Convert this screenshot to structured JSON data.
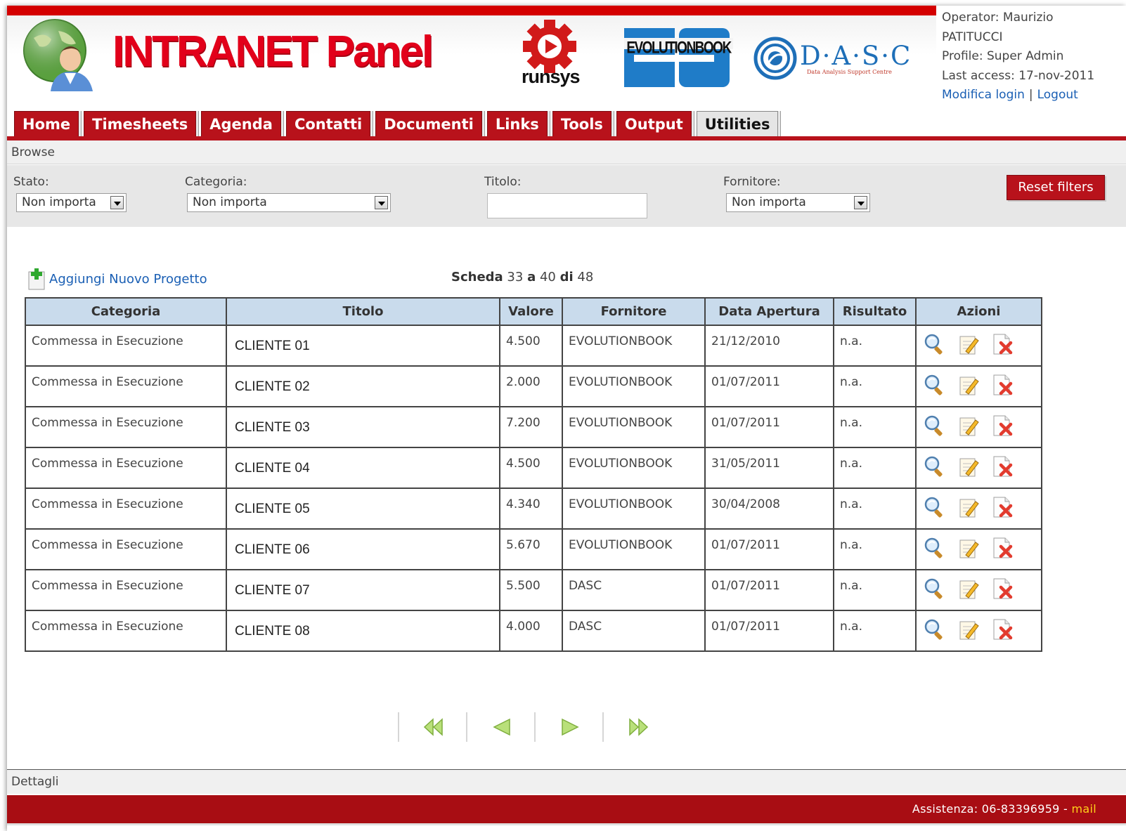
{
  "brand": {
    "title": "INTRANET Panel",
    "runsys": "runsys",
    "evolutionbook": "EVOLUTIONBOOK",
    "dasc": "D·A·S·C",
    "dasc_sub": "Data Analysis Support Centre"
  },
  "user": {
    "operator_line1": "Operator: Maurizio",
    "operator_line2": "PATITUCCI",
    "profile": "Profile: Super Admin",
    "last_access": "Last access: 17-nov-2011",
    "modifica_login": "Modifica login",
    "separator": "|",
    "logout": "Logout"
  },
  "tabs": [
    {
      "label": "Home"
    },
    {
      "label": "Timesheets"
    },
    {
      "label": "Agenda"
    },
    {
      "label": "Contatti"
    },
    {
      "label": "Documenti"
    },
    {
      "label": "Links"
    },
    {
      "label": "Tools"
    },
    {
      "label": "Output"
    },
    {
      "label": "Utilities",
      "active": true
    }
  ],
  "breadcrumb": "Browse",
  "filters": {
    "stato_label": "Stato:",
    "stato_value": "Non importa",
    "categoria_label": "Categoria:",
    "categoria_value": "Non importa",
    "titolo_label": "Titolo:",
    "titolo_value": "",
    "fornitore_label": "Fornitore:",
    "fornitore_value": "Non importa",
    "reset_label": "Reset filters"
  },
  "add_project": "Aggiungi Nuovo Progetto",
  "pager": {
    "scheda": "Scheda",
    "from": "33",
    "a": "a",
    "to": "40",
    "di": "di",
    "total": "48"
  },
  "table": {
    "headers": [
      "Categoria",
      "Titolo",
      "Valore",
      "Fornitore",
      "Data Apertura",
      "Risultato",
      "Azioni"
    ],
    "rows": [
      [
        "Commessa in Esecuzione",
        "CLIENTE 01",
        "4.500",
        "EVOLUTIONBOOK",
        "21/12/2010",
        "n.a."
      ],
      [
        "Commessa in Esecuzione",
        "CLIENTE 02",
        "2.000",
        "EVOLUTIONBOOK",
        "01/07/2011",
        "n.a."
      ],
      [
        "Commessa in Esecuzione",
        "CLIENTE 03",
        "7.200",
        "EVOLUTIONBOOK",
        "01/07/2011",
        "n.a."
      ],
      [
        "Commessa in Esecuzione",
        "CLIENTE 04",
        "4.500",
        "EVOLUTIONBOOK",
        "31/05/2011",
        "n.a."
      ],
      [
        "Commessa in Esecuzione",
        "CLIENTE 05",
        "4.340",
        "EVOLUTIONBOOK",
        "30/04/2008",
        "n.a."
      ],
      [
        "Commessa in Esecuzione",
        "CLIENTE 06",
        "5.670",
        "EVOLUTIONBOOK",
        "01/07/2011",
        "n.a."
      ],
      [
        "Commessa in Esecuzione",
        "CLIENTE 07",
        "5.500",
        "DASC",
        "01/07/2011",
        "n.a."
      ],
      [
        "Commessa in Esecuzione",
        "CLIENTE 08",
        "4.000",
        "DASC",
        "01/07/2011",
        "n.a."
      ]
    ],
    "row_actions": [
      "view-icon",
      "edit-icon",
      "delete-icon"
    ]
  },
  "pagination_icons": [
    "first-page-icon",
    "prev-page-icon",
    "next-page-icon",
    "last-page-icon"
  ],
  "details_label": "Dettagli",
  "footer": {
    "assistenza": "Assistenza: 06-83396959 -",
    "mail": "mail"
  },
  "colors": {
    "brand_red": "#d40000",
    "tab_red": "#b8121b",
    "header_blue": "#c9dbec",
    "link_blue": "#1a5fb4",
    "footer_red": "#a80d13"
  }
}
